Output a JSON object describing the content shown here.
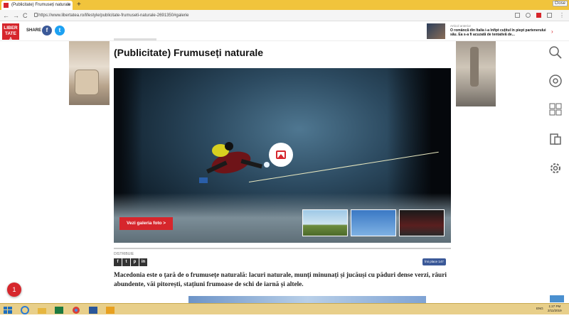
{
  "browser": {
    "tab_title": "(Publicitate) Frumuseți naturale",
    "new_tab": "+",
    "tab_close": "×",
    "window_close": "Close",
    "back": "←",
    "forward": "→",
    "reload": "C",
    "url": "https://www.libertatea.ro/lifestyle/publicitate-frumuseti-naturale-2691350#galerie"
  },
  "header": {
    "logo": "LIBERTATEA",
    "share_label": "SHARE",
    "facebook": "f",
    "twitter": "t",
    "promo_tag": "Articol anterior",
    "promo_text": "O româncă din Italia i-a înfipt cuțitul în piept partenerului său. Ea s-a fi acuzată de tentativă de...",
    "promo_arrow": "›"
  },
  "article": {
    "title": "(Publicitate) Frumuseți naturale",
    "gallery_button": "Vezi galeria foto >",
    "share_label": "DISTRIBUIE",
    "share_buttons": [
      "f",
      "t",
      "p",
      "in"
    ],
    "likes_label": "Îmi place 147",
    "lead": "Macedonia este o țară de o frumusețe naturală: lacuri naturale, munți minunați și jucăuși cu păduri dense verzi, râuri abundente, văi pitorești, stațiuni frumoase de schi de iarnă și altele."
  },
  "notification_count": "1",
  "taskbar": {
    "time": "1:27 PM",
    "date": "2/11/2019",
    "lang": "ENG"
  },
  "colors": {
    "brand": "#d6262c",
    "tabbar": "#f1c43c",
    "taskbar": "#e8cf8a"
  }
}
